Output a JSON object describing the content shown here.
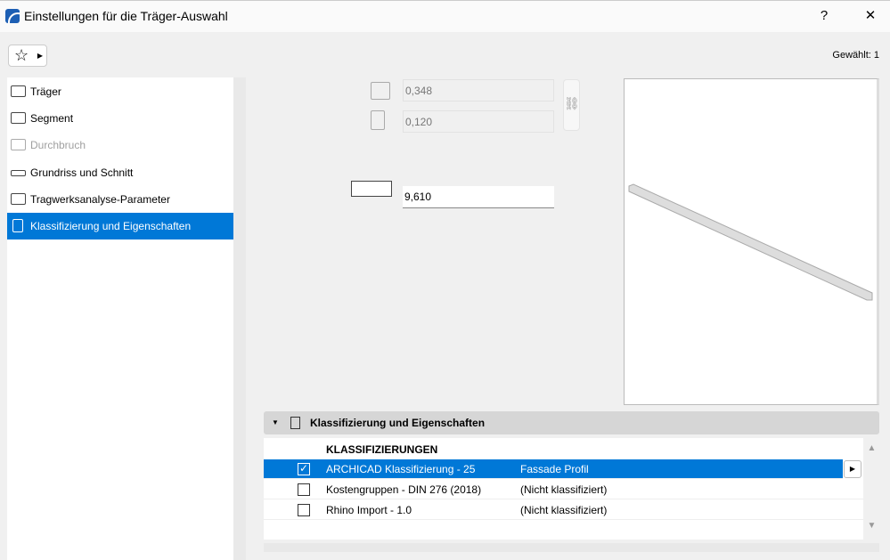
{
  "window": {
    "title": "Einstellungen für die Träger-Auswahl",
    "help": "?",
    "close": "✕"
  },
  "toolbar": {
    "favorites_icon": "☆",
    "selected_count": "Gewählt: 1"
  },
  "sidebar": {
    "items": [
      {
        "label": "Träger",
        "state": "normal"
      },
      {
        "label": "Segment",
        "state": "normal"
      },
      {
        "label": "Durchbruch",
        "state": "disabled"
      },
      {
        "label": "Grundriss und Schnitt",
        "state": "normal"
      },
      {
        "label": "Tragwerksanalyse-Parameter",
        "state": "normal"
      },
      {
        "label": "Klassifizierung und Eigenschaften",
        "state": "selected"
      }
    ]
  },
  "geometry": {
    "height": "0,348",
    "width": "0,120",
    "length": "9,610"
  },
  "panel": {
    "title": "Klassifizierung und Eigenschaften",
    "heading": "KLASSIFIZIERUNGEN",
    "rows": [
      {
        "system": "ARCHICAD Klassifizierung - 25",
        "value": "Fassade Profil",
        "checked": "✓"
      },
      {
        "system": "Kostengruppen - DIN 276 (2018)",
        "value": "(Nicht klassifiziert)",
        "checked": ""
      },
      {
        "system": "Rhino Import - 1.0",
        "value": "(Nicht klassifiziert)",
        "checked": ""
      }
    ]
  },
  "colors": {
    "accent": "#0078d7"
  }
}
